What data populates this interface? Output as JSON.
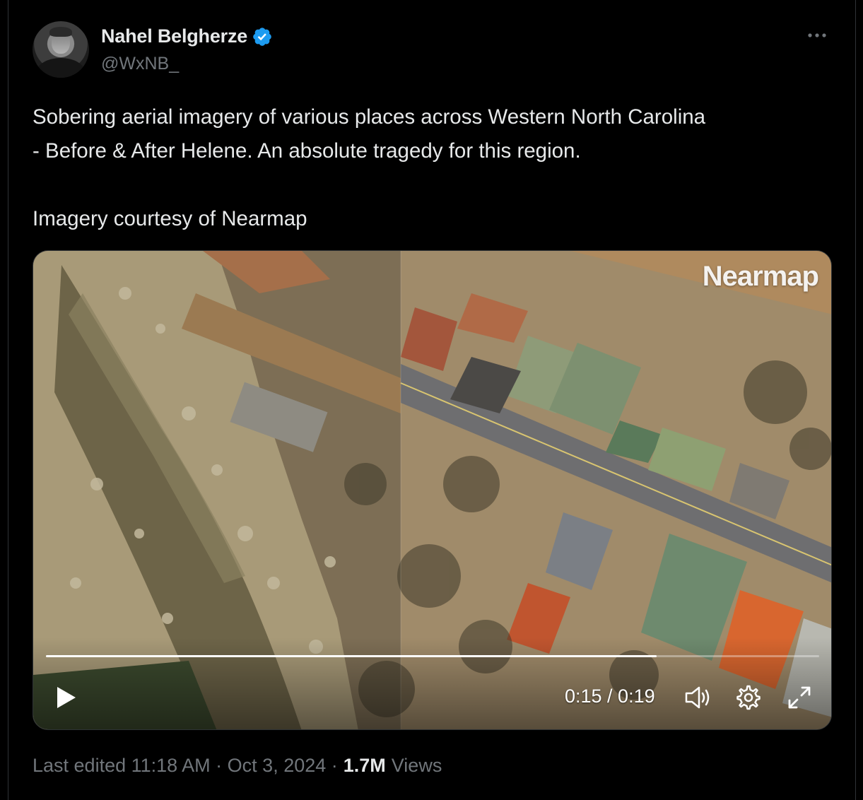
{
  "author": {
    "display_name": "Nahel Belgherze",
    "handle": "@WxNB_",
    "verified_icon": "verified-badge-icon",
    "verified_color": "#1d9bf0"
  },
  "tweet": {
    "text": "Sobering aerial imagery of various places across Western North Carolina\n- Before & After Helene. An absolute tragedy for this region.\n\nImagery courtesy of Nearmap"
  },
  "video": {
    "watermark": "Nearmap",
    "time_readout": "0:15 / 0:19",
    "progress_fraction": 0.79,
    "controls": [
      "play-icon",
      "volume-icon",
      "settings-icon",
      "fullscreen-icon"
    ]
  },
  "meta": {
    "edited": "Last edited 11:18 AM · Oct 3, 2024 ·",
    "views_count": "1.7M",
    "views_label": "Views"
  },
  "colors": {
    "background": "#000000",
    "text_primary": "#e7e9ea",
    "text_secondary": "#71767b"
  }
}
